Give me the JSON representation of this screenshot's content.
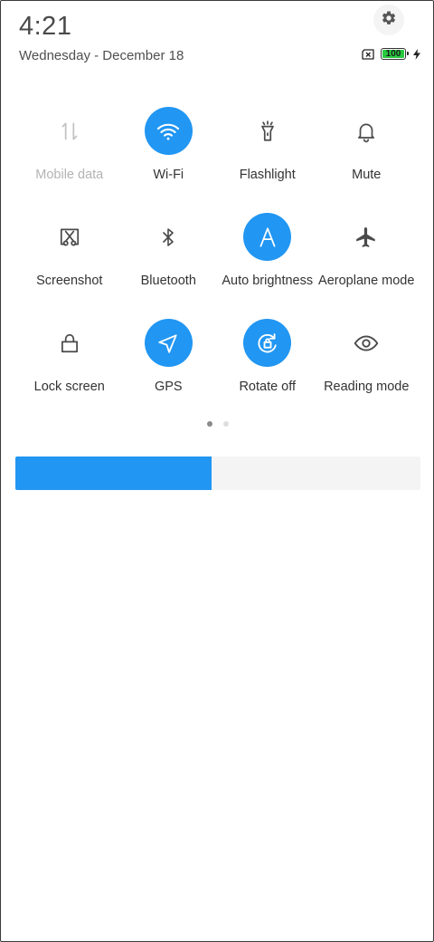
{
  "header": {
    "time": "4:21",
    "date": "Wednesday - December 18"
  },
  "status": {
    "battery_level": "100",
    "battery_color": "#27c93f",
    "icons": [
      "sim-missing-icon",
      "battery-icon",
      "charging-icon"
    ]
  },
  "accent_color": "#2196f3",
  "tiles": [
    {
      "label": "Mobile data",
      "icon": "mobile-data-icon",
      "active": false,
      "disabled": true
    },
    {
      "label": "Wi-Fi",
      "icon": "wifi-icon",
      "active": true,
      "disabled": false
    },
    {
      "label": "Flashlight",
      "icon": "flashlight-icon",
      "active": false,
      "disabled": false
    },
    {
      "label": "Mute",
      "icon": "bell-icon",
      "active": false,
      "disabled": false
    },
    {
      "label": "Screenshot",
      "icon": "screenshot-icon",
      "active": false,
      "disabled": false
    },
    {
      "label": "Bluetooth",
      "icon": "bluetooth-icon",
      "active": false,
      "disabled": false
    },
    {
      "label": "Auto brightness",
      "icon": "auto-brightness-icon",
      "active": true,
      "disabled": false
    },
    {
      "label": "Aeroplane mode",
      "icon": "airplane-icon",
      "active": false,
      "disabled": false
    },
    {
      "label": "Lock screen",
      "icon": "lock-icon",
      "active": false,
      "disabled": false
    },
    {
      "label": "GPS",
      "icon": "navigation-arrow-icon",
      "active": true,
      "disabled": false
    },
    {
      "label": "Rotate off",
      "icon": "rotate-lock-icon",
      "active": true,
      "disabled": false
    },
    {
      "label": "Reading mode",
      "icon": "eye-icon",
      "active": false,
      "disabled": false
    }
  ],
  "pager": {
    "pages": 2,
    "current": 1
  },
  "brightness": {
    "level": 0.485
  }
}
